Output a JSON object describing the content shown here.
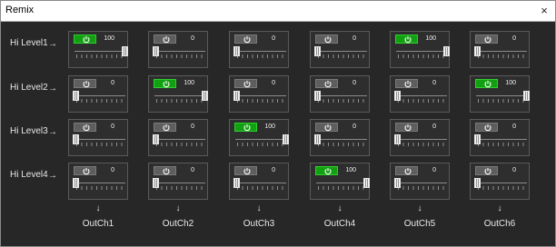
{
  "window": {
    "title": "Remix",
    "close_glyph": "×"
  },
  "rows": [
    {
      "label": "Hi Level1",
      "arrow": "→"
    },
    {
      "label": "Hi Level2",
      "arrow": "→"
    },
    {
      "label": "Hi Level3",
      "arrow": "→"
    },
    {
      "label": "Hi Level4",
      "arrow": "→"
    }
  ],
  "outputs": [
    {
      "label": "OutCh1",
      "arrow": "↓"
    },
    {
      "label": "OutCh2",
      "arrow": "↓"
    },
    {
      "label": "OutCh3",
      "arrow": "↓"
    },
    {
      "label": "OutCh4",
      "arrow": "↓"
    },
    {
      "label": "OutCh5",
      "arrow": "↓"
    },
    {
      "label": "OutCh6",
      "arrow": "↓"
    }
  ],
  "matrix": [
    [
      {
        "value": 100,
        "on": true
      },
      {
        "value": 0,
        "on": false
      },
      {
        "value": 0,
        "on": false
      },
      {
        "value": 0,
        "on": false
      },
      {
        "value": 100,
        "on": true
      },
      {
        "value": 0,
        "on": false
      }
    ],
    [
      {
        "value": 0,
        "on": false
      },
      {
        "value": 100,
        "on": true
      },
      {
        "value": 0,
        "on": false
      },
      {
        "value": 0,
        "on": false
      },
      {
        "value": 0,
        "on": false
      },
      {
        "value": 100,
        "on": true
      }
    ],
    [
      {
        "value": 0,
        "on": false
      },
      {
        "value": 0,
        "on": false
      },
      {
        "value": 100,
        "on": true
      },
      {
        "value": 0,
        "on": false
      },
      {
        "value": 0,
        "on": false
      },
      {
        "value": 0,
        "on": false
      }
    ],
    [
      {
        "value": 0,
        "on": false
      },
      {
        "value": 0,
        "on": false
      },
      {
        "value": 0,
        "on": false
      },
      {
        "value": 100,
        "on": true
      },
      {
        "value": 0,
        "on": false
      },
      {
        "value": 0,
        "on": false
      }
    ]
  ],
  "colors": {
    "on": "#12a012",
    "off": "#5e5e5e",
    "background": "#272727"
  },
  "icons": {
    "toggle": "power-icon",
    "close": "close-icon"
  }
}
